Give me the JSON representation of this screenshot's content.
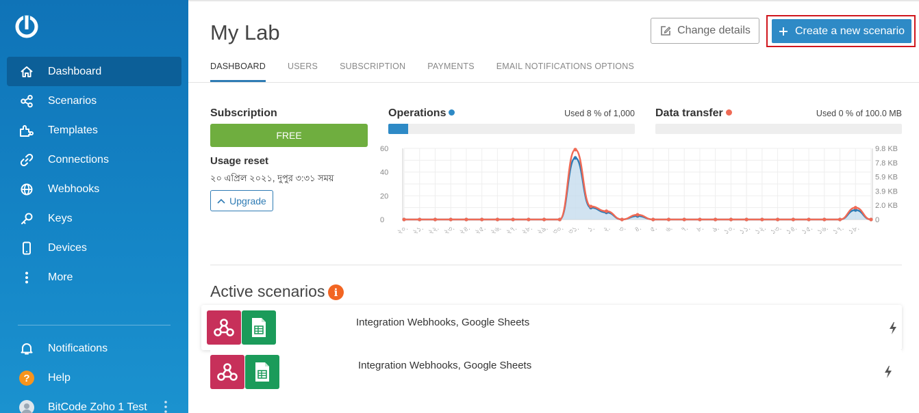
{
  "sidebar": {
    "items": [
      {
        "label": "Dashboard",
        "icon": "home-icon",
        "active": true
      },
      {
        "label": "Scenarios",
        "icon": "share-icon"
      },
      {
        "label": "Templates",
        "icon": "puzzle-icon"
      },
      {
        "label": "Connections",
        "icon": "link-icon"
      },
      {
        "label": "Webhooks",
        "icon": "globe-icon"
      },
      {
        "label": "Keys",
        "icon": "key-icon"
      },
      {
        "label": "Devices",
        "icon": "mobile-icon"
      },
      {
        "label": "More",
        "icon": "more-vertical-icon"
      }
    ],
    "bottom": [
      {
        "label": "Notifications",
        "icon": "bell-icon"
      },
      {
        "label": "Help",
        "icon": "help-icon"
      },
      {
        "label": "BitCode Zoho 1 Test",
        "icon": "avatar"
      }
    ]
  },
  "header": {
    "title": "My Lab",
    "change_details": "Change details",
    "create_scenario": "Create a new scenario"
  },
  "tabs": [
    "DASHBOARD",
    "USERS",
    "SUBSCRIPTION",
    "PAYMENTS",
    "EMAIL NOTIFICATIONS OPTIONS"
  ],
  "subscription": {
    "title": "Subscription",
    "plan": "FREE",
    "usage_reset_title": "Usage reset",
    "usage_reset_date": "২০ এপ্রিল ২০২১, দুপুর ৩:৩১ সময়",
    "upgrade": "Upgrade"
  },
  "operations": {
    "title": "Operations",
    "used_text": "Used 8 % of 1,000",
    "percent": 8,
    "color": "#2e8ac6"
  },
  "data_transfer": {
    "title": "Data transfer",
    "used_text": "Used 0 % of 100.0 MB",
    "percent": 0,
    "color": "#ef6a55"
  },
  "chart_data": {
    "type": "area",
    "categories": [
      "২০.",
      "২১.",
      "২২.",
      "২৩.",
      "২৪.",
      "২৫.",
      "২৬.",
      "২৭.",
      "২৮.",
      "২৯.",
      "৩০.",
      "৩১.",
      "১.",
      "২.",
      "৩.",
      "৪.",
      "৫.",
      "৬.",
      "৭.",
      "৮.",
      "৯.",
      "১০.",
      "১১.",
      "১২.",
      "১৩.",
      "১৪.",
      "১৫.",
      "১৬.",
      "১৭.",
      "১৮."
    ],
    "series": [
      {
        "axis": "left",
        "color": "#2e7bb4",
        "values": [
          0,
          0,
          0,
          0,
          0,
          0,
          0,
          0,
          0,
          0,
          0,
          52,
          10,
          6,
          0,
          3,
          0,
          0,
          0,
          0,
          0,
          0,
          0,
          0,
          0,
          0,
          0,
          0,
          0,
          8,
          0
        ]
      },
      {
        "axis": "right",
        "color": "#ef6a55",
        "values": [
          0,
          0,
          0,
          0,
          0,
          0,
          0,
          0,
          0,
          0,
          0,
          59,
          11,
          7,
          0,
          4,
          0,
          0,
          0,
          0,
          0,
          0,
          0,
          0,
          0,
          0,
          0,
          0,
          0,
          10,
          0
        ]
      }
    ],
    "y_left_ticks": [
      "60",
      "40",
      "20",
      "0"
    ],
    "y_right_ticks": [
      "9.8 KB",
      "7.8 KB",
      "5.9 KB",
      "3.9 KB",
      "2.0 KB",
      "0"
    ],
    "ylim": [
      0,
      60
    ],
    "grid": true
  },
  "active_scenarios": {
    "title": "Active scenarios",
    "info": "i",
    "items": [
      {
        "name": "Integration Webhooks, Google Sheets"
      },
      {
        "name": "Integration Webhooks, Google Sheets"
      }
    ]
  }
}
